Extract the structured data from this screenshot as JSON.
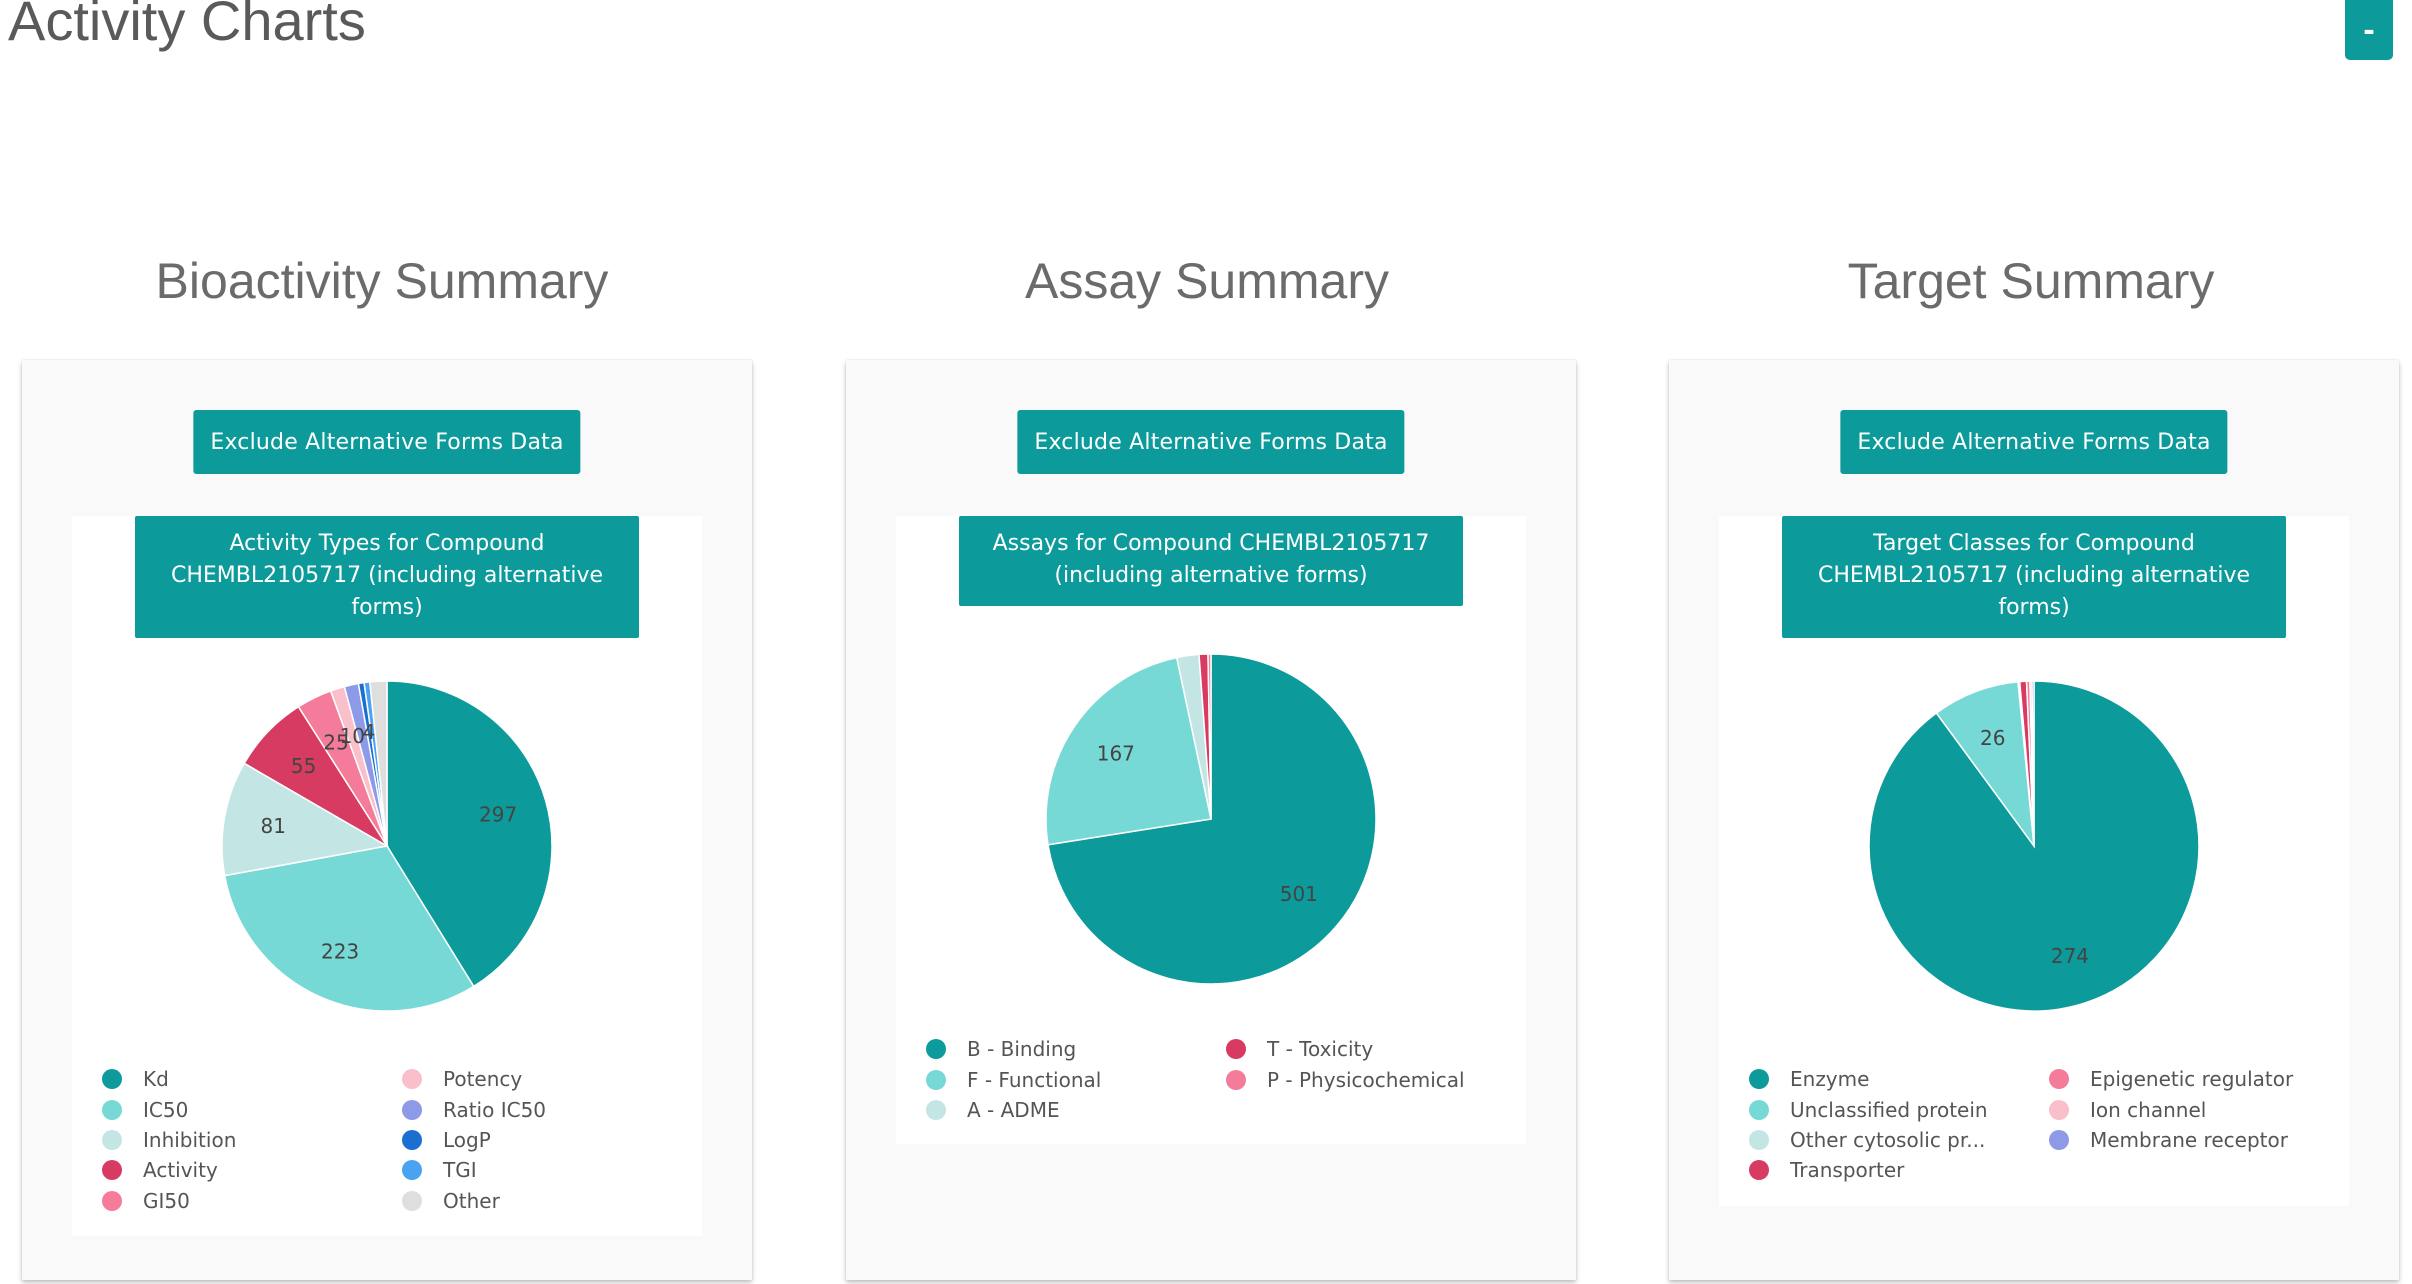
{
  "page": {
    "title": "Activity Charts",
    "collapse_label": "-"
  },
  "charts": [
    {
      "heading": "Bioactivity Summary",
      "button_label": "Exclude Alternative Forms Data",
      "chart_title": "Activity Types for Compound CHEMBL2105717 (including alternative forms)",
      "legend_rows": 5
    },
    {
      "heading": "Assay Summary",
      "button_label": "Exclude Alternative Forms Data",
      "chart_title": "Assays for Compound CHEMBL2105717 (including alternative forms)",
      "legend_rows": 3
    },
    {
      "heading": "Target Summary",
      "button_label": "Exclude Alternative Forms Data",
      "chart_title": "Target Classes for Compound CHEMBL2105717 (including alternative forms)",
      "legend_rows": 4
    }
  ],
  "chart_data": [
    {
      "type": "pie",
      "title": "Activity Types for Compound CHEMBL2105717 (including alternative forms)",
      "categories": [
        "Kd",
        "IC50",
        "Inhibition",
        "Activity",
        "GI50",
        "Potency",
        "Ratio IC50",
        "LogP",
        "TGI",
        "Other"
      ],
      "values": [
        297,
        223,
        81,
        55,
        25,
        10,
        10,
        4,
        4,
        12
      ],
      "shown_labels": [
        "297",
        "223",
        "81",
        "55",
        "25",
        "10",
        "",
        "4",
        "",
        ""
      ],
      "colors": [
        "#0d9a9b",
        "#77d9d5",
        "#c3e6e4",
        "#d73b62",
        "#f47c9a",
        "#f9bfcb",
        "#8d9ae8",
        "#1a6fd1",
        "#4aa3f0",
        "#dedede"
      ],
      "legend_placement": "bottom"
    },
    {
      "type": "pie",
      "title": "Assays for Compound CHEMBL2105717 (including alternative forms)",
      "categories": [
        "B - Binding",
        "F - Functional",
        "A - ADME",
        "T - Toxicity",
        "P - Physicochemical"
      ],
      "values": [
        501,
        167,
        15,
        6,
        2
      ],
      "shown_labels": [
        "501",
        "167",
        "",
        "",
        ""
      ],
      "colors": [
        "#0d9a9b",
        "#77d9d5",
        "#c3e6e4",
        "#d73b62",
        "#f47c9a"
      ],
      "legend_placement": "bottom"
    },
    {
      "type": "pie",
      "title": "Target Classes for Compound CHEMBL2105717 (including alternative forms)",
      "categories": [
        "Enzyme",
        "Unclassified protein",
        "Other cytosolic pr...",
        "Transporter",
        "Epigenetic regulator",
        "Ion channel",
        "Membrane receptor"
      ],
      "values": [
        274,
        26,
        0.5,
        2,
        1,
        0.6,
        0.6
      ],
      "shown_labels": [
        "274",
        "26",
        "",
        "",
        "",
        "",
        ""
      ],
      "colors": [
        "#0d9a9b",
        "#77d9d5",
        "#c3e6e4",
        "#d73b62",
        "#f47c9a",
        "#f9bfcb",
        "#8d9ae8"
      ],
      "legend_placement": "bottom"
    }
  ]
}
